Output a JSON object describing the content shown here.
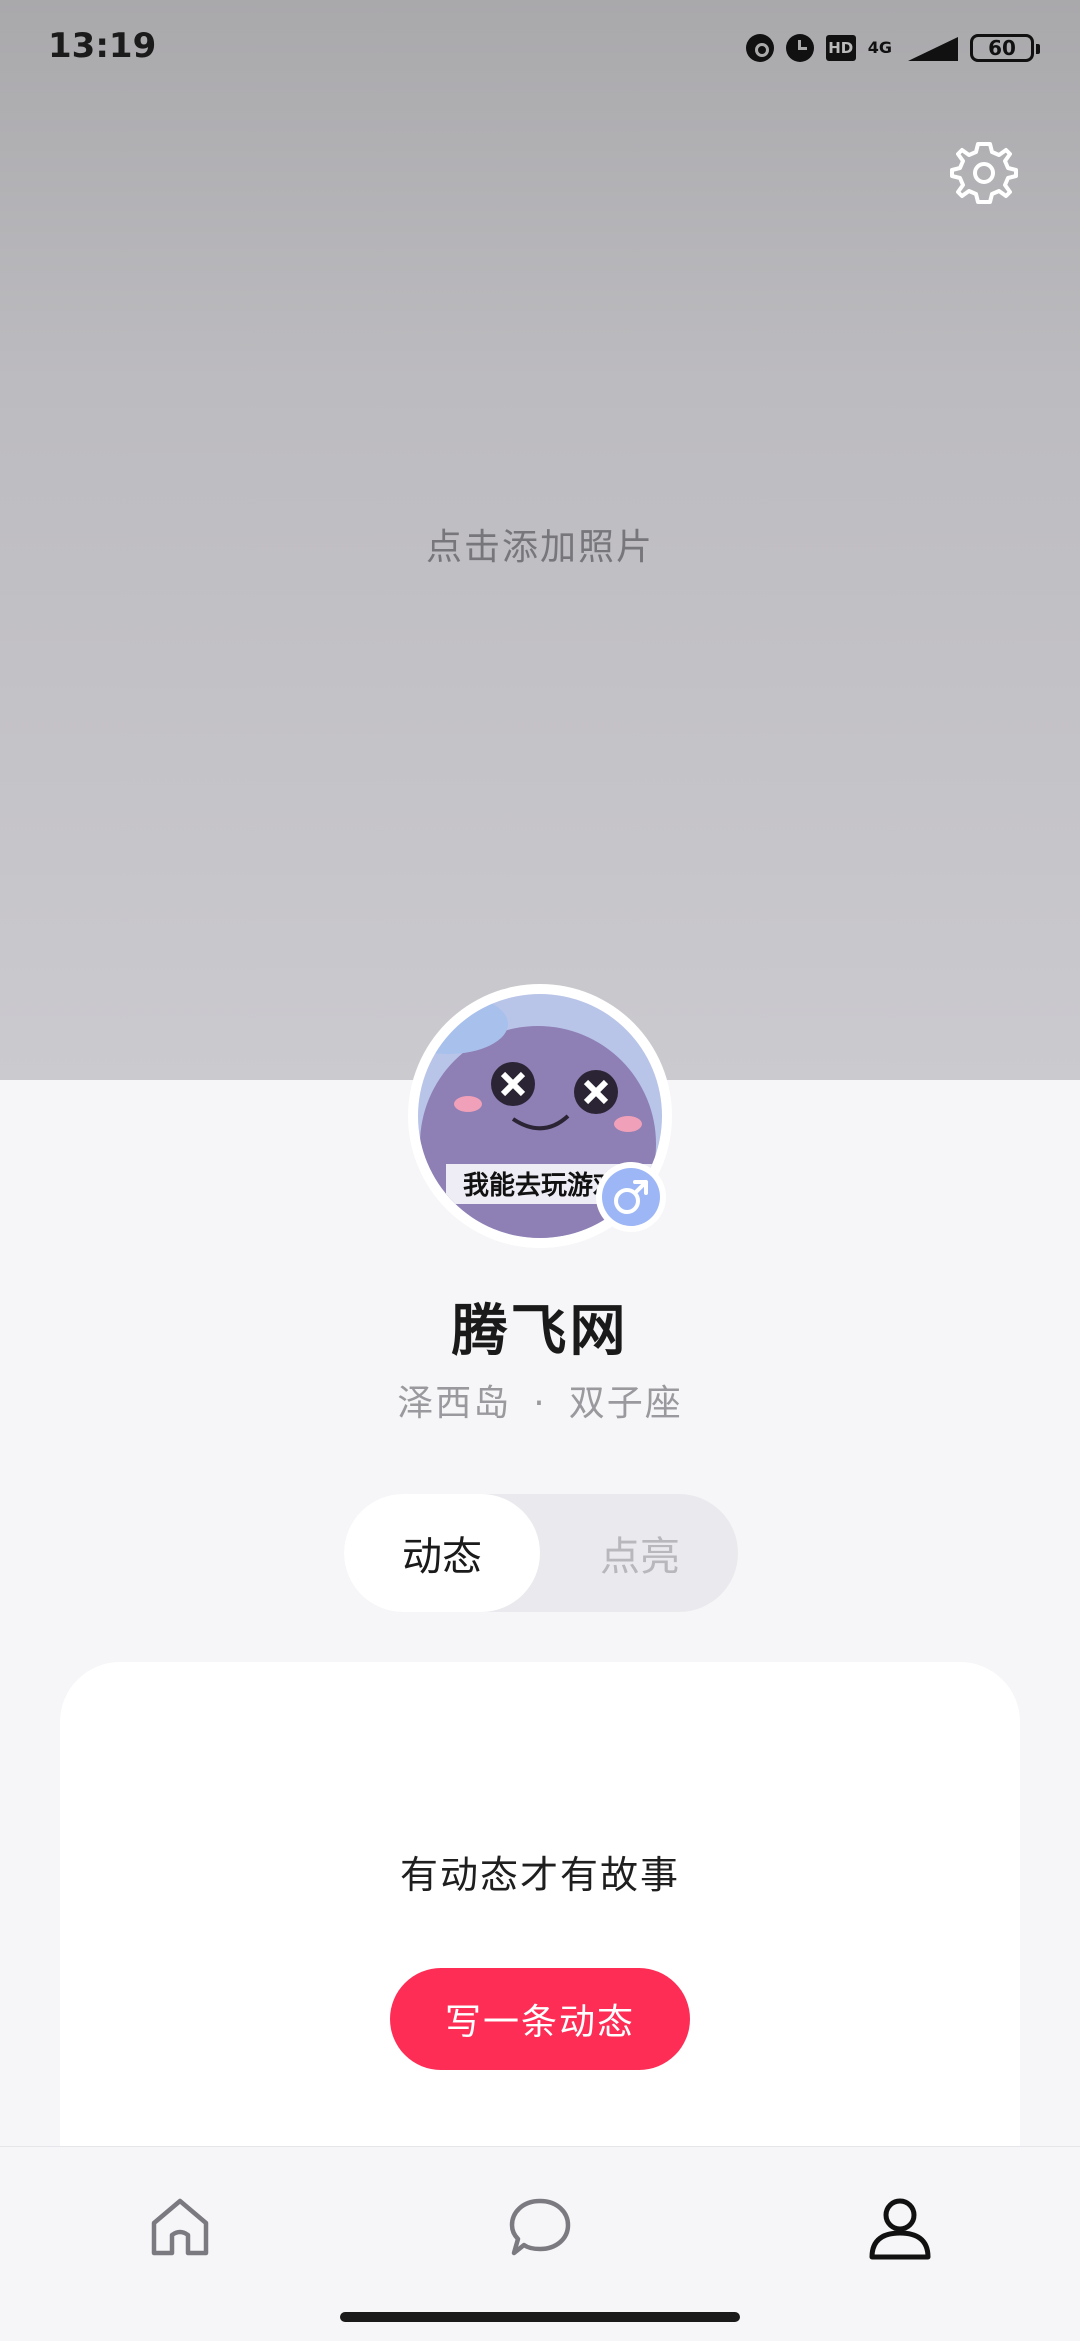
{
  "status_bar": {
    "time": "13:19",
    "network": "4G",
    "battery": "60",
    "hd_label": "HD"
  },
  "cover": {
    "hint": "点击添加照片"
  },
  "profile": {
    "username": "腾飞网",
    "location": "泽西岛",
    "separator": "·",
    "zodiac": "双子座",
    "gender_symbol": "♂",
    "avatar_caption": "我能去玩游戏吗"
  },
  "tabs": [
    {
      "label": "动态",
      "active": true
    },
    {
      "label": "点亮",
      "active": false
    }
  ],
  "feed": {
    "empty_text": "有动态才有故事",
    "write_button": "写一条动态"
  },
  "nav": {
    "items": [
      "home-icon",
      "message-icon",
      "profile-icon"
    ],
    "active": "profile-icon"
  },
  "colors": {
    "accent": "#fe2d55",
    "gender_badge": "#9db7f6",
    "cover_top": "#a9a8ab",
    "cover_bottom": "#cbcacf"
  }
}
